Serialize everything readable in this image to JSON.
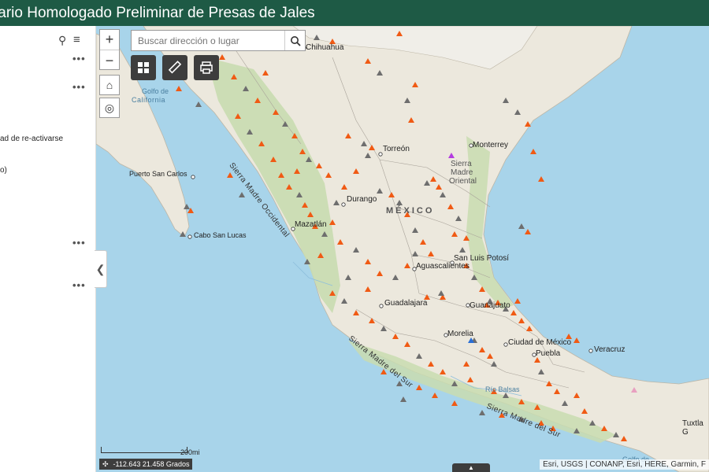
{
  "header": {
    "title": "tario Homologado Preliminar de Presas de Jales"
  },
  "sidebar": {
    "text_1": "ad de re-activarse",
    "text_2": "o)"
  },
  "search": {
    "placeholder": "Buscar dirección o lugar"
  },
  "scale": {
    "label": "200mi"
  },
  "coords": {
    "value": "-112.643 21.458 Grados"
  },
  "attribution": "Esri, USGS | CONANP, Esri, HERE, Garmin, F",
  "map_labels": {
    "chihuahua": "Chihuahua",
    "golfo_de": "Golfo de",
    "california": "California",
    "sierra_madre_occidental": "Sierra Madre Occidental",
    "torreon": "Torreón",
    "monterrey": "Monterrey",
    "sierra": "Sierra",
    "madre": "Madre",
    "oriental": "Oriental",
    "puerto_san_carlos": "Puerto San Carlos",
    "durango": "Durango",
    "mexico": "MÉXICO",
    "cabo_san_lucas": "Cabo San Lucas",
    "mazatlan": "Mazatlán",
    "san_luis_potosi": "San Luis Potosí",
    "aguascalientes": "Aguascalientes",
    "guadalajara": "Guadalajara",
    "guanajuato": "Guanajuato",
    "morelia": "Morelia",
    "ciudad_de_mexico": "Ciudad de México",
    "veracruz": "Veracruz",
    "puebla": "Puebla",
    "sierra_madre_del_sur_1": "Sierra Madre del Sur",
    "sierra_madre_del_sur_2": "Sierra Madre del Sur",
    "rio_balsas": "Río Balsas",
    "tuxtla": "Tuxtla G",
    "golfo_bottom": "Golfo de"
  },
  "colors": {
    "header": "#1e5a45",
    "water": "#a8d4ea",
    "land": "#ece8dd",
    "vegetation": "#c9dcb0",
    "marker_orange": "#f05a14",
    "marker_gray": "#6e6e6e",
    "marker_blue": "#2a6fd6",
    "marker_purple": "#b43ce0"
  },
  "icons": {
    "search": "search-icon",
    "filter": "filter-list-icon",
    "home": "home-icon",
    "locate": "locate-icon",
    "basemap": "basemap-grid-icon",
    "measure": "ruler-icon",
    "print": "printer-icon",
    "collapse": "chevron-left-icon",
    "expand": "chevron-up-icon"
  }
}
